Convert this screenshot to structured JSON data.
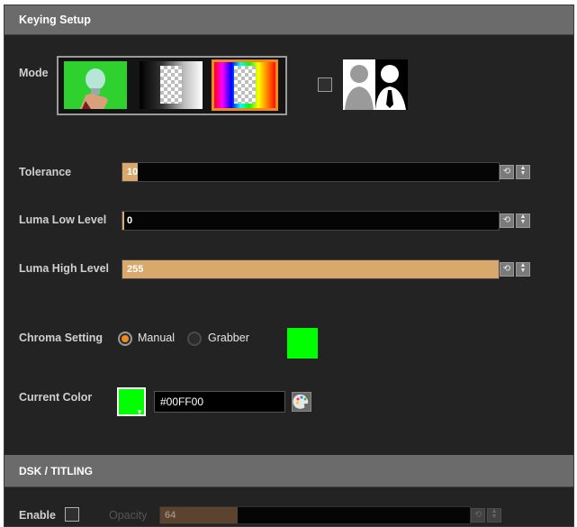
{
  "keying": {
    "title": "Keying Setup",
    "mode_label": "Mode",
    "mode_options": [
      {
        "name": "green-screen",
        "selected": false
      },
      {
        "name": "luma-gradient",
        "selected": false
      },
      {
        "name": "chroma-spectrum",
        "selected": true
      }
    ],
    "mask_checkbox_checked": false,
    "tolerance": {
      "label": "Tolerance",
      "value": "10",
      "fraction": 0.04
    },
    "luma_low": {
      "label": "Luma Low Level",
      "value": "0",
      "fraction": 0.0
    },
    "luma_high": {
      "label": "Luma High Level",
      "value": "255",
      "fraction": 1.0
    },
    "chroma_setting": {
      "label": "Chroma Setting",
      "options": [
        "Manual",
        "Grabber"
      ],
      "selected": "Manual",
      "swatch_color": "#00FF00"
    },
    "current_color": {
      "label": "Current Color",
      "hex": "#00FF00",
      "swatch_color": "#00FF00"
    }
  },
  "dsk": {
    "title": "DSK / TITLING",
    "enable_label": "Enable",
    "enable_checked": false,
    "opacity": {
      "label": "Opacity",
      "value": "64",
      "fraction": 0.25
    }
  },
  "colors": {
    "accent": "#F08A1C",
    "slider_fill": "#D9A96C",
    "panel_bg": "#232323",
    "header_bg": "#6B6B6B"
  }
}
